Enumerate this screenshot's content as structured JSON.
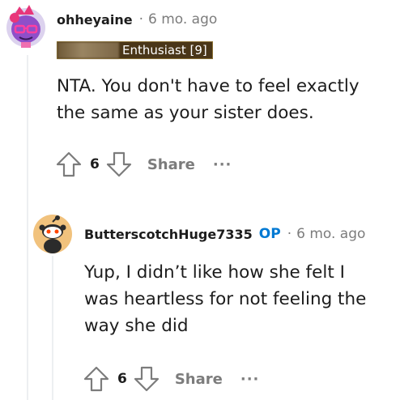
{
  "comment1": {
    "username": "ohheyaine",
    "separator": "·",
    "time": "6 mo. ago",
    "flair": "Enthusiast [9]",
    "body_lines": [
      "NTA. You don't have to feel exactly",
      "the same as your sister does."
    ],
    "votes": "6",
    "share_label": "Share",
    "more_label": "···"
  },
  "comment2": {
    "username": "ButterscotchHuge7335",
    "op_badge": "OP",
    "separator": "·",
    "time": "6 mo. ago",
    "body_lines": [
      "Yup, I didn’t like how she felt I",
      "was heartless for not feeling the",
      "way she did"
    ],
    "votes": "6",
    "share_label": "Share",
    "more_label": "···"
  },
  "colors": {
    "avatar1_bg": "#d9d0ea",
    "avatar2_bg": "#f0c27a",
    "op": "#0079d3",
    "meta": "#7c7c7c"
  }
}
